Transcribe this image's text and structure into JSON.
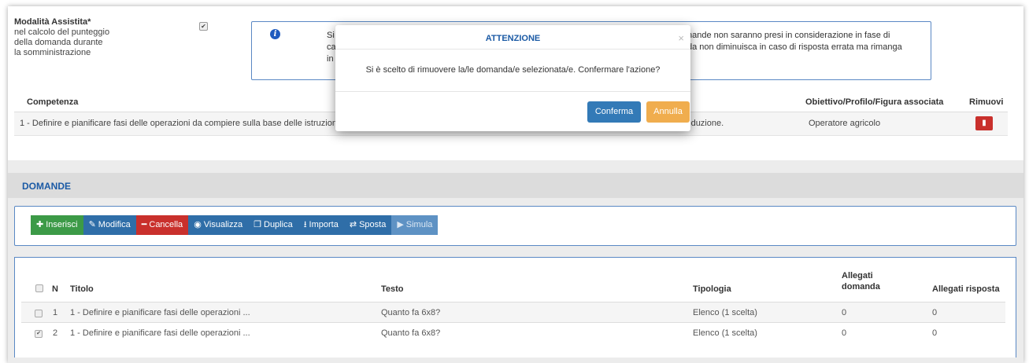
{
  "modalita": {
    "title": "Modalità Assistita*",
    "line1": "nel calcolo del punteggio",
    "line2": "della domanda durante",
    "line3": "la somministrazione",
    "checked": true
  },
  "info": {
    "left1": "Si",
    "left2": "ca",
    "left3": "in",
    "right1": "nande non saranno presi in considerazione in fase di",
    "right2": "da non diminuisca in caso di risposta errata ma rimanga"
  },
  "competenza": {
    "headers": {
      "competenza": "Competenza",
      "obiettivo": "Obiettivo/Profilo/Figura associata",
      "rimuovi": "Rimuovi"
    },
    "row": {
      "text": "1 - Definire e pianificare fasi delle operazioni da compiere sulla base delle istruzioni ricevute e del sistema di relazione, ottimizzando i processi lavorativi e l'uso dei mezzi di produzione.",
      "obiettivo": "Operatore agricolo"
    }
  },
  "domande": {
    "title": "DOMANDE",
    "toolbar": {
      "inserisci": "Inserisci",
      "modifica": "Modifica",
      "cancella": "Cancella",
      "visualizza": "Visualizza",
      "duplica": "Duplica",
      "importa": "Importa",
      "sposta": "Sposta",
      "simula": "Simula"
    },
    "columns": {
      "n": "N",
      "titolo": "Titolo",
      "testo": "Testo",
      "tipologia": "Tipologia",
      "allegati_domanda_1": "Allegati",
      "allegati_domanda_2": "domanda",
      "allegati_risposta": "Allegati risposta"
    },
    "rows": [
      {
        "n": "1",
        "titolo": "1 - Definire e pianificare fasi delle operazioni ...",
        "testo": "Quanto fa 6x8?",
        "tipologia": "Elenco (1 scelta)",
        "allegati_domanda": "0",
        "allegati_risposta": "0",
        "checked": false
      },
      {
        "n": "2",
        "titolo": "1 - Definire e pianificare fasi delle operazioni ...",
        "testo": "Quanto fa 6x8?",
        "tipologia": "Elenco (1 scelta)",
        "allegati_domanda": "0",
        "allegati_risposta": "0",
        "checked": true
      }
    ]
  },
  "modal": {
    "title": "ATTENZIONE",
    "close": "×",
    "body": "Si è scelto di rimuovere la/le domanda/e selezionata/e. Confermare l'azione?",
    "confirm": "Conferma",
    "cancel": "Annulla"
  },
  "colors": {
    "primary": "#337ab7",
    "warning": "#f0ad4e",
    "danger": "#c9302c",
    "success": "#3c9a47",
    "title_blue": "#1b5aa5"
  }
}
